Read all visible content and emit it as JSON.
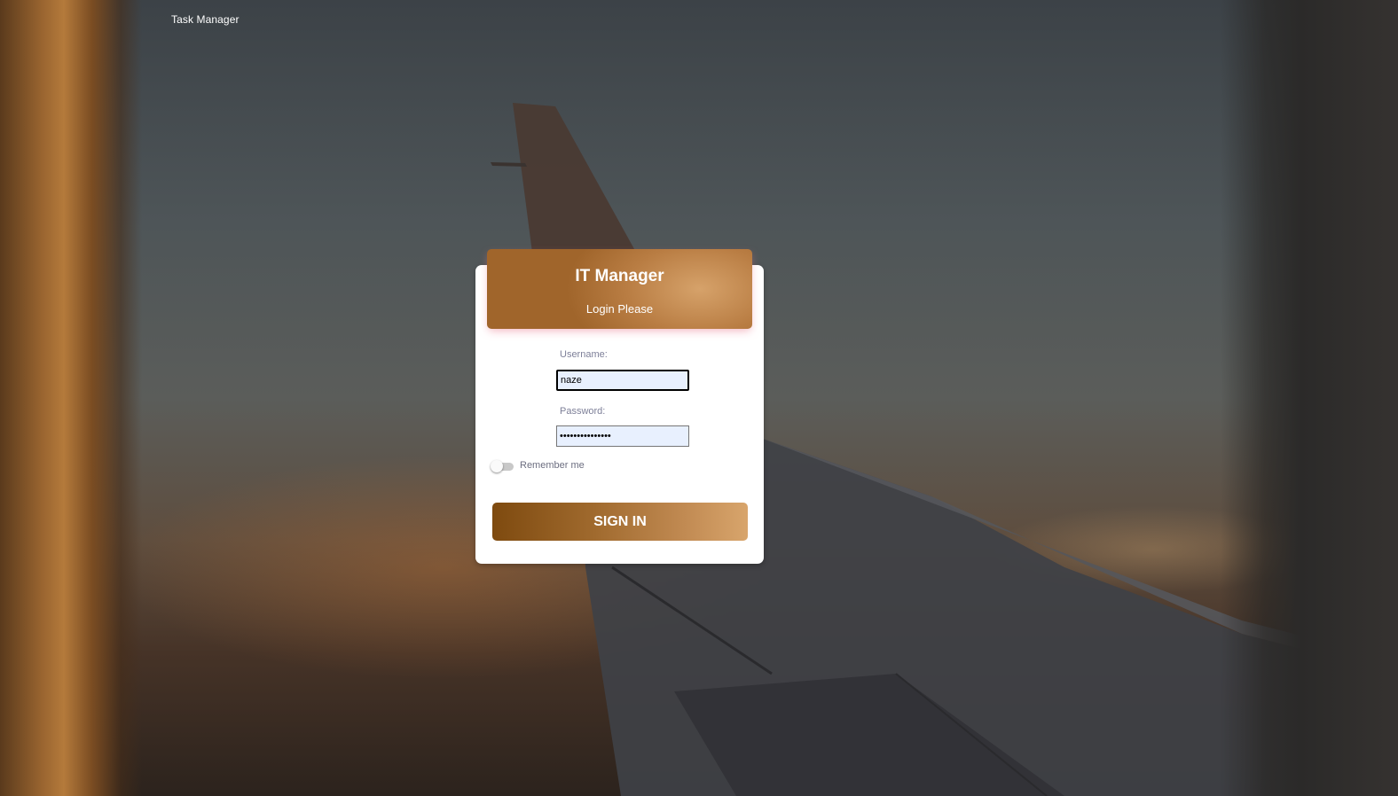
{
  "brand": {
    "name": "Task Manager"
  },
  "login": {
    "title": "IT Manager",
    "subtitle": "Login Please",
    "username_label": "Username:",
    "username_value": "naze",
    "password_label": "Password:",
    "password_value": "•••••••••••••••",
    "remember_label": "Remember me",
    "remember_checked": false,
    "submit_label": "SIGN IN"
  },
  "colors": {
    "accent_dark": "#7e4a0f",
    "accent_light": "#d8a56c",
    "input_bg": "#e8f0fe",
    "label_text": "#7d7f98"
  }
}
